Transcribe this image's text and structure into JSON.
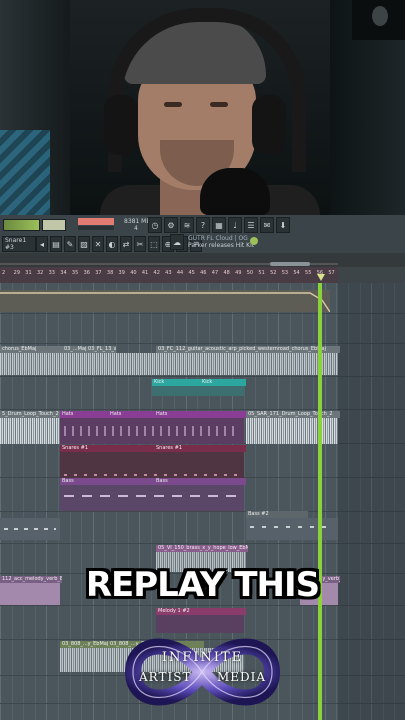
{
  "webcam": {
    "description_icon": "webcam-feed"
  },
  "toolbar": {
    "memory": "8381 MB",
    "memory_sub": "4",
    "channel_select": "Snare1 #3",
    "news_line1": "GUTR FL Cloud | OG",
    "news_line2": "Parker releases Hit Kit"
  },
  "ruler": {
    "ticks": [
      "2",
      "29",
      "31",
      "32",
      "33",
      "34",
      "35",
      "36",
      "37",
      "38",
      "39",
      "40",
      "41",
      "42",
      "43",
      "44",
      "45",
      "46",
      "47",
      "48",
      "49",
      "50",
      "51",
      "52",
      "53",
      "54",
      "55",
      "56",
      "57"
    ]
  },
  "clips": {
    "chorus_top": "chorus_EbMaj",
    "chorus_mid1": "03_...Maj",
    "chorus_mid2": "03_Maj",
    "chorus_mid3": "03_FL_13_ai_EbMaj",
    "chorus_long": "03_FC_112_guitar_acoustic_arp_picked_westernroad_chorus_EbMaj",
    "kick_a": "Kick",
    "kick_b": "Kick",
    "drum_loop_left": "5_Drum_Loop_Touch_2",
    "hats_a": "Hats",
    "hats_b": "Hats",
    "hats_c": "Hats",
    "drum_loop_right": "05_SAR_171_Drum_Loop_Touch_2",
    "snares_a": "Snares #1",
    "snares_b": "Snares #1",
    "bass_a": "Bass",
    "bass_b": "Bass",
    "bass_c": "Bass #2",
    "brass_clip": "05_VI_150_brass_x_y_hope_low_EbMaj",
    "melody_left": "112_acc_melody_verb_EbMaj",
    "melody_right": "...melody_verb_EbMaj",
    "melody_1": "Melody 1 #2",
    "bottom_a": "03_808_...y_EbMaj",
    "bottom_b": "03_808_...y_EbMaj",
    "bottom_c": "03_808..."
  },
  "overlay_text": "REPLAY THIS",
  "logo": {
    "line1": "INFINITE",
    "line2": "ARTIST",
    "line3": "MEDIA"
  },
  "colors": {
    "kick": "#2ba7a0",
    "hats": "#8a3d94",
    "snares": "#7a2d4a",
    "bass": "#7a4a8c",
    "playhead": "#8ad13c",
    "ruler": "#4a3c44"
  }
}
